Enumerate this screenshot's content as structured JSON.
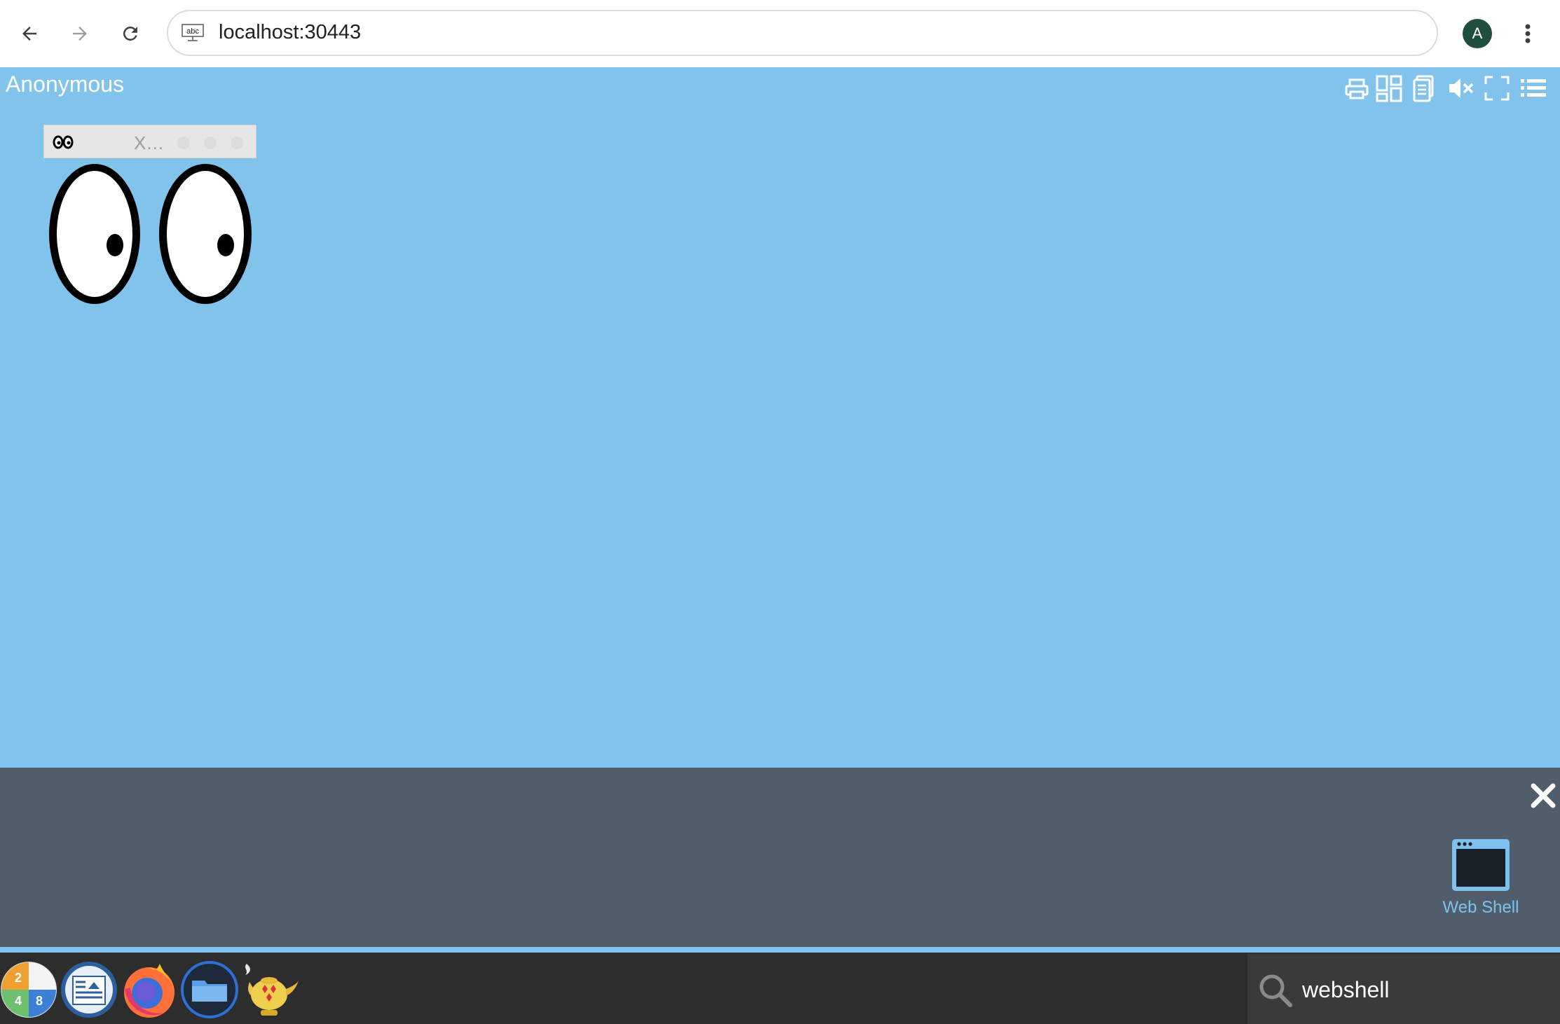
{
  "browser": {
    "url": "localhost:30443",
    "site_icon_text": "abc",
    "profile_initial": "A"
  },
  "desktop": {
    "user_label": "Anonymous",
    "background_color": "#82c3ec",
    "toolbar_icons": [
      "printer-icon",
      "grid-icon",
      "clipboard-icon",
      "mute-icon",
      "fullscreen-icon",
      "menu-icon"
    ]
  },
  "xeyes_window": {
    "title": "X..."
  },
  "launcher": {
    "app_label": "Web Shell",
    "background_color": "#505d6b"
  },
  "taskbar": {
    "apps": [
      "calculator-icon",
      "document-viewer-icon",
      "firefox-icon",
      "file-manager-icon",
      "genie-lamp-icon"
    ],
    "search_value": "webshell"
  }
}
